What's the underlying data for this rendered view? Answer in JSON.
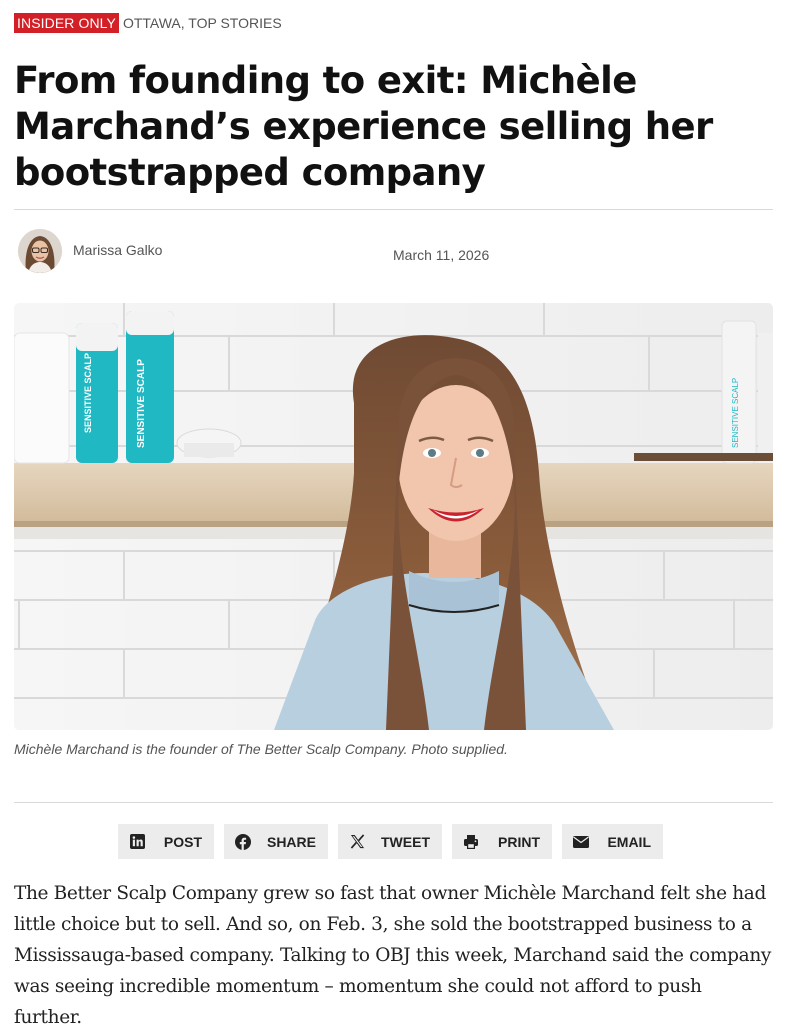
{
  "tags": {
    "badge": "INSIDER ONLY",
    "categories": "OTTAWA, TOP STORIES"
  },
  "article": {
    "headline": "From founding to exit: Michèle Marchand’s experience selling her bootstrapped company",
    "author": "Marissa Galko",
    "date": "March 11, 2026",
    "photo_caption": "Michèle Marchand is the founder of The Better Scalp Company. Photo supplied.",
    "photo_product_text": "SENSITIVE SCALP",
    "body": "The Better Scalp Company grew so fast that owner Michèle Marchand felt she had little choice but to sell. And so, on Feb. 3, she sold the bootstrapped business to a Mississauga-based company.  Talking to OBJ this week, Marchand said the company was seeing incredible momentum – momentum she could not afford to push further."
  },
  "share": {
    "post_label": "POST",
    "share_label": "SHARE",
    "tweet_label": "TWEET",
    "print_label": "PRINT",
    "email_label": "EMAIL"
  },
  "colors": {
    "badge_red": "#d31f26",
    "share_bg": "#ececec",
    "bottle_teal": "#1fb8c3"
  }
}
